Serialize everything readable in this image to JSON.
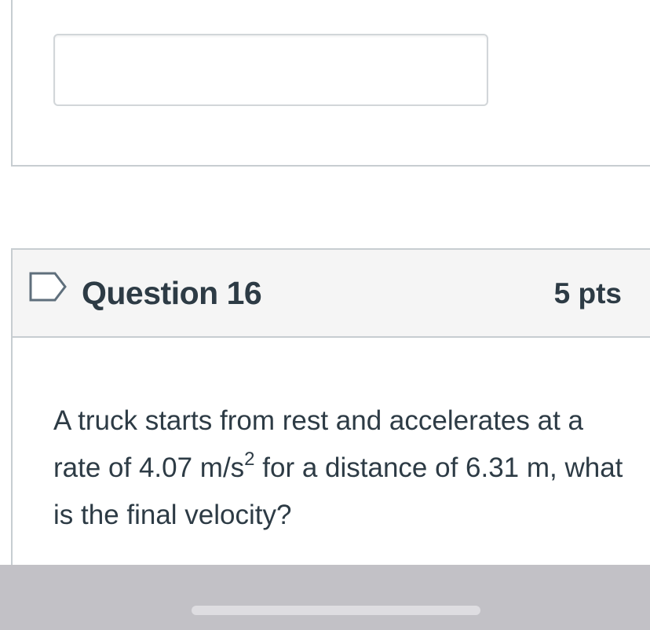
{
  "previous_question": {
    "answer_value": ""
  },
  "question": {
    "title": "Question 16",
    "points": "5 pts",
    "text_part1": "A truck starts from rest and accelerates at a rate of 4.07 m/s",
    "text_superscript": "2",
    "text_part2": " for a distance of 6.31 m, what is the final velocity?",
    "flag_icon": "flag-outline-icon"
  },
  "colors": {
    "text": "#2d3b45",
    "header_background": "#f5f5f5",
    "border": "#c7cdd1",
    "system_bar": "#c2c1c6"
  }
}
